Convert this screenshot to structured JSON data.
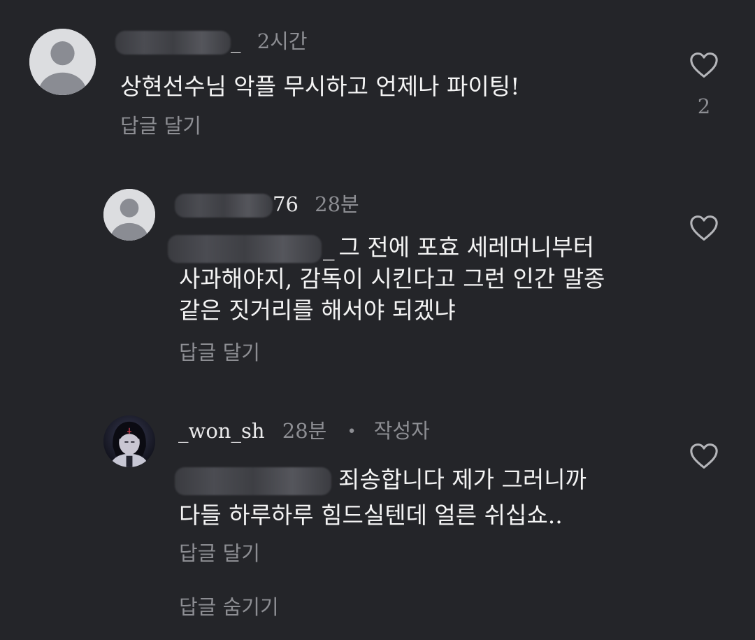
{
  "comments": [
    {
      "username_suffix": "_",
      "time": "2시간",
      "text": "상현선수님 악플 무시하고 언제나 파이팅!",
      "reply_label": "답글 달기",
      "likes": "2"
    },
    {
      "username_suffix": "76",
      "time": "28분",
      "mention_suffix": "_",
      "text_line1": "그 전에 포효 세레머니부터",
      "text_line2": "사과해야지, 감독이 시킨다고 그런 인간 말종",
      "text_line3": "같은 짓거리를 해서야 되겠냐",
      "reply_label": "답글 달기"
    },
    {
      "username": "_won_sh",
      "time": "28분",
      "author_badge": "작성자",
      "text_line1": "죄송합니다 제가 그러니까",
      "text_line2": "다들 하루하루 힘드실텐데 얼른 쉬십쇼..",
      "reply_label": "답글 달기"
    }
  ],
  "hide_replies_label": "답글 숨기기",
  "icons": {
    "avatar": "default-avatar-icon",
    "like": "heart-outline-icon"
  }
}
